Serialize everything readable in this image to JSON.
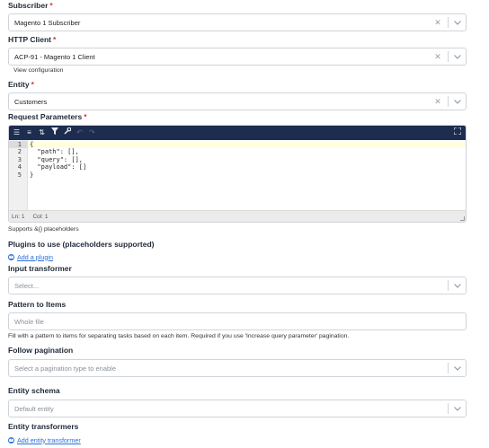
{
  "subscriber": {
    "label": "Subscriber",
    "required": "*",
    "value": "Magento 1 Subscriber"
  },
  "http_client": {
    "label": "HTTP Client",
    "required": "*",
    "value": "ACP-91 - Magento 1 Client",
    "view_link": "View configuration"
  },
  "entity": {
    "label": "Entity",
    "required": "*",
    "value": "Customers"
  },
  "request_parameters": {
    "label": "Request Parameters",
    "required": "*",
    "line_numbers": [
      "1",
      "2",
      "3",
      "4",
      "5"
    ],
    "code_lines": [
      "{",
      "  \"path\": [],",
      "  \"query\": [],",
      "  \"payload\": []",
      "}"
    ],
    "status_line": "Ln: 1",
    "status_col": "Col: 1",
    "help": "Supports &{} placeholders"
  },
  "plugins": {
    "label": "Plugins to use (placeholders supported)",
    "add_link": "Add a plugin"
  },
  "input_transformer": {
    "label": "Input transformer",
    "placeholder": "Select..."
  },
  "pattern_to_items": {
    "label": "Pattern to Items",
    "placeholder": "Whole file",
    "help": "Fill with a pattern to items for separating tasks based on each item. Required if you use 'Increase query parameter' pagination."
  },
  "follow_pagination": {
    "label": "Follow pagination",
    "placeholder": "Select a pagination type to enable"
  },
  "entity_schema": {
    "label": "Entity schema",
    "placeholder": "Default entity"
  },
  "entity_transformers": {
    "label": "Entity transformers",
    "add_link": "Add entity transformer"
  },
  "icons": {
    "clear": "close-icon",
    "dropdown": "chevron-down-icon",
    "toolbar": [
      "format-icon",
      "compact-icon",
      "sort-icon",
      "filter-icon",
      "repair-icon",
      "undo-icon",
      "redo-icon",
      "fullscreen-icon"
    ]
  },
  "colors": {
    "toolbar_bg": "#1d2d4f",
    "link": "#2a6fdb",
    "required": "#d63031",
    "active_line": "#ffffe0"
  }
}
